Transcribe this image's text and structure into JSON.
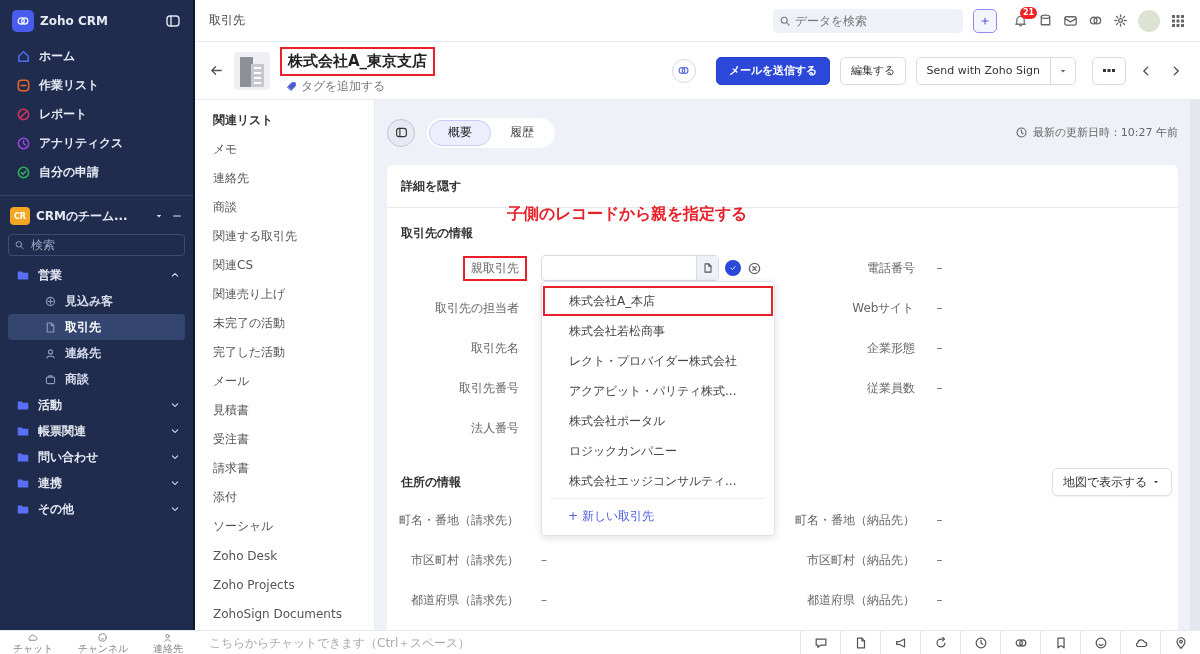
{
  "sidebar": {
    "app_name": "Zoho CRM",
    "nav": [
      {
        "label": "ホーム",
        "color": "#4f6bf5"
      },
      {
        "label": "作業リスト",
        "color": "#e8682c"
      },
      {
        "label": "レポート",
        "color": "#d9325e"
      },
      {
        "label": "アナリティクス",
        "color": "#9b45e0"
      },
      {
        "label": "自分の申請",
        "color": "#2fb15a"
      }
    ],
    "team": {
      "badge": "CR",
      "name": "CRMのチーム..."
    },
    "search": {
      "placeholder": "検索"
    },
    "folders": [
      {
        "label": "営業",
        "expanded": true,
        "children": [
          {
            "label": "見込み客",
            "selected": false
          },
          {
            "label": "取引先",
            "selected": true
          },
          {
            "label": "連絡先",
            "selected": false
          },
          {
            "label": "商談",
            "selected": false
          }
        ]
      },
      {
        "label": "活動",
        "expanded": false
      },
      {
        "label": "帳票関連",
        "expanded": false
      },
      {
        "label": "問い合わせ",
        "expanded": false
      },
      {
        "label": "連携",
        "expanded": false
      },
      {
        "label": "その他",
        "expanded": false
      }
    ]
  },
  "bottom_apps": [
    {
      "label": "チャット"
    },
    {
      "label": "チャンネル"
    },
    {
      "label": "連絡先"
    }
  ],
  "chat": {
    "placeholder": "こちらからチャットできます（Ctrl＋スペース）"
  },
  "topbar": {
    "breadcrumb": "取引先",
    "search": {
      "placeholder": "データを検索"
    },
    "notifications": "21"
  },
  "record": {
    "title": "株式会社A_東京支店",
    "highlighted": true,
    "tag": "タグを追加する",
    "actions": {
      "send_mail": "メールを送信する",
      "edit": "編集する",
      "sign": "Send with Zoho Sign"
    }
  },
  "related_list": {
    "title": "関連リスト",
    "items": [
      "メモ",
      "連絡先",
      "商談",
      "関連する取引先",
      "関連CS",
      "関連売り上げ",
      "未完了の活動",
      "完了した活動",
      "メール",
      "見積書",
      "受注書",
      "請求書",
      "添付",
      "ソーシャル",
      "Zoho Desk",
      "Zoho Projects",
      "ZohoSign Documents"
    ]
  },
  "tabs": [
    {
      "label": "概要",
      "selected": true
    },
    {
      "label": "履歴",
      "selected": false
    }
  ],
  "last_modified": "最新の更新日時：10:27 午前",
  "details": {
    "toggle": "詳細を隠す",
    "annotation": "子側のレコードから親を指定する",
    "info": {
      "title": "取引先の情報",
      "fields": [
        {
          "label": "親取引先",
          "kind": "lookup",
          "highlighted": true
        },
        {
          "label": "電話番号",
          "kind": "text",
          "value": "–"
        },
        {
          "label": "取引先の担当者",
          "kind": "text"
        },
        {
          "label": "Webサイト",
          "kind": "text",
          "value": "–"
        },
        {
          "label": "取引先名",
          "kind": "text"
        },
        {
          "label": "企業形態",
          "kind": "text",
          "value": "–"
        },
        {
          "label": "取引先番号",
          "kind": "text"
        },
        {
          "label": "従業員数",
          "kind": "text",
          "value": "–"
        },
        {
          "label": "法人番号",
          "kind": "text"
        }
      ]
    },
    "lookup_dropdown": {
      "options": [
        {
          "label": "株式会社A_本店",
          "highlighted": true
        },
        {
          "label": "株式会社若松商事",
          "highlighted": false
        },
        {
          "label": "レクト・プロバイダー株式会社",
          "highlighted": false
        },
        {
          "label": "アクアビット・パリティ株式...",
          "highlighted": false
        },
        {
          "label": "株式会社ポータル",
          "highlighted": false
        },
        {
          "label": "ロジックカンパニー",
          "highlighted": false
        },
        {
          "label": "株式会社エッジコンサルティ...",
          "highlighted": false
        }
      ],
      "new_link": "+ 新しい取引先"
    },
    "address": {
      "title": "住所の情報",
      "map_button": "地図で表示する",
      "fields": [
        {
          "label": "町名・番地（請求先）"
        },
        {
          "label": "町名・番地（納品先）",
          "value": "–"
        },
        {
          "label": "市区町村（請求先）",
          "value": "–"
        },
        {
          "label": "市区町村（納品先）",
          "value": "–"
        },
        {
          "label": "都道府県（請求先）",
          "value": "–"
        },
        {
          "label": "都道府県（納品先）",
          "value": "–"
        }
      ]
    }
  }
}
